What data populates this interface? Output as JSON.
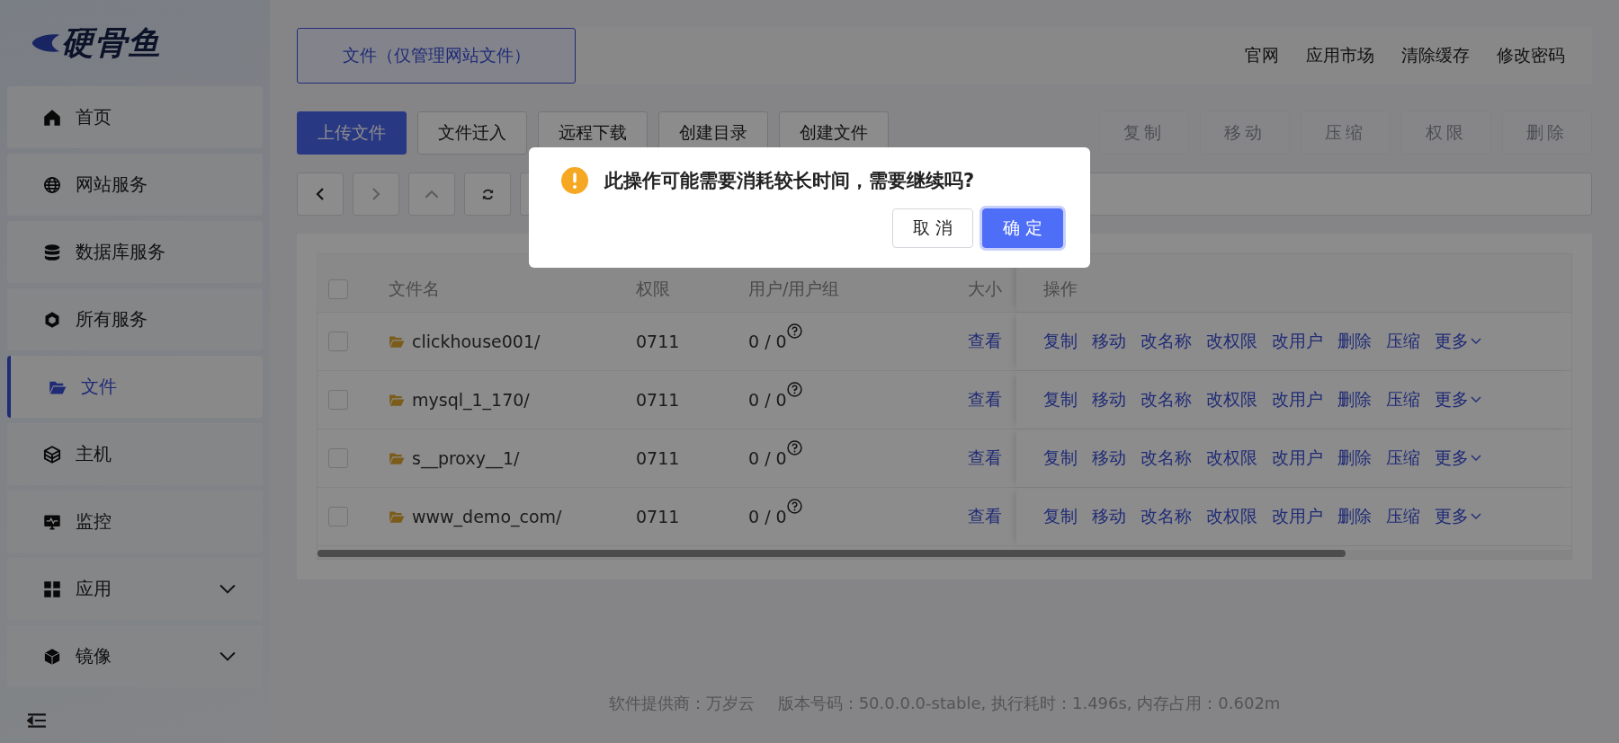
{
  "sidebar": {
    "logo": "硬骨鱼",
    "items": [
      {
        "label": "首页",
        "selected": false,
        "has_submenu": false
      },
      {
        "label": "网站服务",
        "selected": false,
        "has_submenu": false
      },
      {
        "label": "数据库服务",
        "selected": false,
        "has_submenu": false
      },
      {
        "label": "所有服务",
        "selected": false,
        "has_submenu": false
      },
      {
        "label": "文件",
        "selected": true,
        "has_submenu": false
      },
      {
        "label": "主机",
        "selected": false,
        "has_submenu": false
      },
      {
        "label": "监控",
        "selected": false,
        "has_submenu": false
      },
      {
        "label": "应用",
        "selected": false,
        "has_submenu": true
      },
      {
        "label": "镜像",
        "selected": false,
        "has_submenu": true
      }
    ]
  },
  "header": {
    "tabs": [
      {
        "label": "文件（仅管理网站文件）",
        "selected": true
      }
    ],
    "links": [
      "官网",
      "应用市场",
      "清除缓存",
      "修改密码"
    ]
  },
  "toolbar": {
    "buttons": [
      {
        "label": "上传文件",
        "primary": true
      },
      {
        "label": "文件迁入",
        "primary": false
      },
      {
        "label": "远程下载",
        "primary": false
      },
      {
        "label": "创建目录",
        "primary": false
      },
      {
        "label": "创建文件",
        "primary": false
      }
    ],
    "batch_buttons": [
      {
        "label": "复制",
        "disabled": true
      },
      {
        "label": "移动",
        "disabled": true
      },
      {
        "label": "压缩",
        "disabled": true
      },
      {
        "label": "权限",
        "disabled": true
      },
      {
        "label": "删除",
        "disabled": true
      }
    ]
  },
  "table": {
    "columns": [
      "文件名",
      "权限",
      "用户/用户组",
      "大小",
      "操作"
    ],
    "header_checked": false,
    "rows": [
      {
        "checked": false,
        "name": "clickhouse001/",
        "perm": "0711",
        "owner": "0 / 0",
        "size_link": "查看",
        "actions": [
          "复制",
          "移动",
          "改名称",
          "改权限",
          "改用户",
          "删除",
          "压缩",
          "更多"
        ]
      },
      {
        "checked": false,
        "name": "mysql_1_170/",
        "perm": "0711",
        "owner": "0 / 0",
        "size_link": "查看",
        "actions": [
          "复制",
          "移动",
          "改名称",
          "改权限",
          "改用户",
          "删除",
          "压缩",
          "更多"
        ]
      },
      {
        "checked": false,
        "name": "s__proxy__1/",
        "perm": "0711",
        "owner": "0 / 0",
        "size_link": "查看",
        "actions": [
          "复制",
          "移动",
          "改名称",
          "改权限",
          "改用户",
          "删除",
          "压缩",
          "更多"
        ]
      },
      {
        "checked": false,
        "name": "www_demo_com/",
        "perm": "0711",
        "owner": "0 / 0",
        "size_link": "查看",
        "actions": [
          "复制",
          "移动",
          "改名称",
          "改权限",
          "改用户",
          "删除",
          "压缩",
          "更多"
        ]
      }
    ]
  },
  "footer": [
    "软件提供商：万岁云",
    "版本号码：50.0.0.0-stable, 执行耗时：1.496s, 内存占用：0.602m"
  ],
  "dialog": {
    "message": "此操作可能需要消耗较长时间，需要继续吗?",
    "buttons": [
      {
        "label": "取 消",
        "primary": false
      },
      {
        "label": "确 定",
        "primary": true
      }
    ]
  }
}
